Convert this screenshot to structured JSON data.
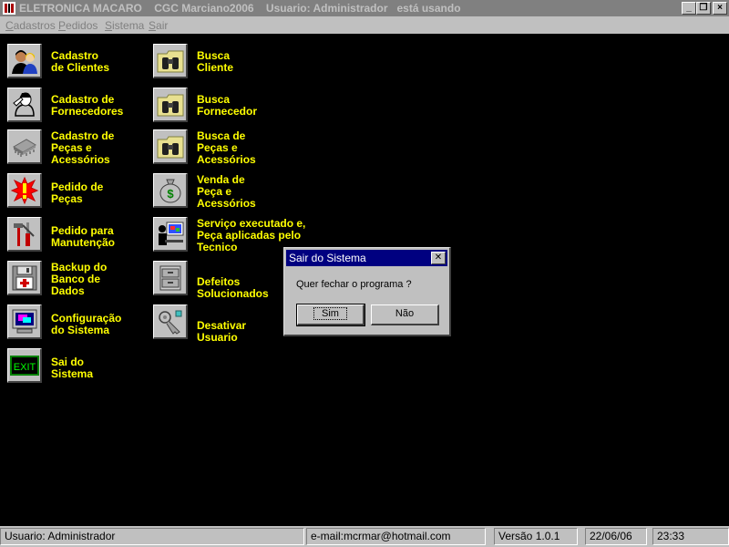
{
  "window": {
    "title": "ELETRONICA MACARO    CGC Marciano2006    Usuario: Administrador   está usando"
  },
  "menu": [
    {
      "underline": "C",
      "rest": "adastros"
    },
    {
      "underline": "P",
      "rest": "edidos"
    },
    {
      "underline": "S",
      "rest": "istema"
    },
    {
      "underline": "S",
      "rest": "air"
    }
  ],
  "items": {
    "cad_clientes": "Cadastro\nde Clientes",
    "cad_fornecedores": "Cadastro de\nFornecedores",
    "cad_pecas": "Cadastro de\nPeças e\nAcessórios",
    "pedido_pecas": "Pedido de\nPeças",
    "pedido_manutencao": "Pedido para\nManutenção",
    "backup": "Backup do\nBanco de\nDados",
    "configuracao": "Configuração\ndo Sistema",
    "sair": "Sai do\nSistema",
    "busca_cliente": "Busca\nCliente",
    "busca_fornecedor": "Busca\nFornecedor",
    "busca_pecas": "Busca de\nPeças e\nAcessórios",
    "venda_peca": "Venda de\nPeça e\nAcessórios",
    "servico": "Serviço executado e,\nPeça aplicadas pelo\nTecnico",
    "defeitos": "Defeitos\nSolucionados",
    "desativar": "Desativar\nUsuario",
    "exit_icon_text": "EXIT"
  },
  "dialog": {
    "title": "Sair do Sistema",
    "message": "Quer fechar o programa ?",
    "yes": "Sim",
    "no": "Não"
  },
  "status": {
    "user": "Usuario: Administrador",
    "email": "e-mail:mcrmar@hotmail.com",
    "version": "Versão 1.0.1",
    "date": "22/06/06",
    "time": "23:33"
  },
  "colors": {
    "background": "#000000",
    "label": "#ffff00",
    "dialog_title": "#000080",
    "chrome": "#c0c0c0"
  },
  "icons": {
    "cad_clientes": "people-icon",
    "cad_fornecedores": "supplier-icon",
    "cad_pecas": "chip-icon",
    "pedido_pecas": "alert-icon",
    "pedido_manutencao": "tools-icon",
    "backup": "floppy-icon",
    "configuracao": "monitor-icon",
    "sair": "exit-icon",
    "busca": "binoculars-folder-icon",
    "venda_peca": "money-bag-icon",
    "servico": "technician-icon",
    "defeitos": "cabinet-icon",
    "desativar": "keys-icon"
  }
}
